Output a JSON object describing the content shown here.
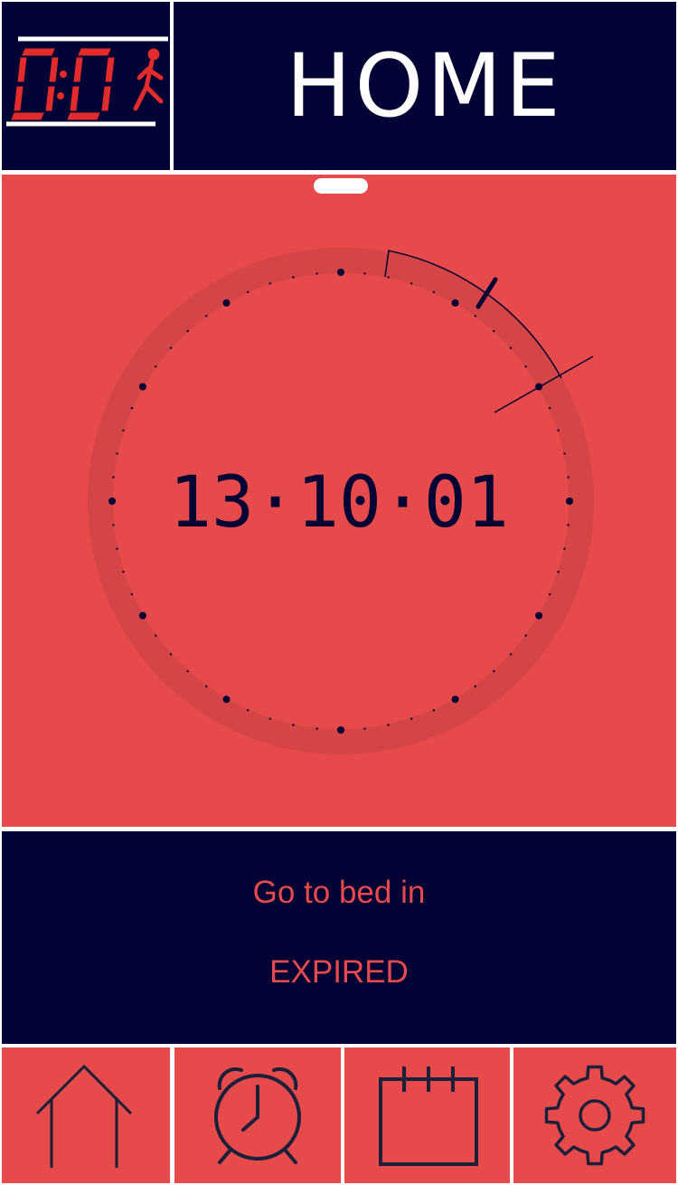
{
  "logo": {
    "digits": "0:0",
    "icon": "running-man-icon"
  },
  "header": {
    "title": "HOME"
  },
  "clock": {
    "time": "13·10·01"
  },
  "info": {
    "label": "Go to bed in",
    "status": "EXPIRED"
  },
  "nav": [
    {
      "icon": "home-icon"
    },
    {
      "icon": "alarm-clock-icon"
    },
    {
      "icon": "calendar-icon"
    },
    {
      "icon": "gear-icon"
    }
  ],
  "colors": {
    "navy": "#000333",
    "red": "#e74a4a",
    "ring": "#d64545",
    "white": "#ffffff"
  }
}
